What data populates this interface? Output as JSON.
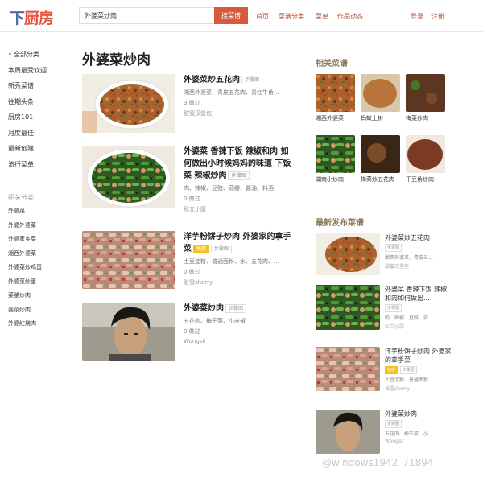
{
  "header": {
    "logo_first": "下",
    "logo_rest": "厨房",
    "search_value": "外婆菜炒肉",
    "search_button": "搜菜谱",
    "nav": [
      "首页",
      "菜谱分类",
      "菜单",
      "作品动态"
    ],
    "login": "登录",
    "register": "注册"
  },
  "sidebar": {
    "items": [
      "全部分类",
      "本周最受欢迎",
      "新秀菜谱",
      "往期头条",
      "厨房101",
      "月度最佳",
      "最新创建",
      "流行菜单"
    ],
    "related_title": "相关分类",
    "related": [
      "外婆菜",
      "外婆外婆菜",
      "外婆家乡菜",
      "湘西外婆菜",
      "外婆菜炒鸡蛋",
      "外婆菜炒蛋",
      "菜脯炒肉",
      "酱菜炒肉",
      "外婆红烧肉"
    ]
  },
  "main": {
    "title": "外婆菜炒肉",
    "recipes": [
      {
        "title": "外婆菜炒五花肉",
        "tag": "步骤图",
        "ingredients": "湘西外婆菜、青皮五花肉、青红牛角...",
        "count": "3 做过",
        "author": "甜蜜汉堡包"
      },
      {
        "title": "外婆菜 香辣下饭 辣椒和肉 如何做出小时候妈妈的味道 下饭菜 辣椒炒肉",
        "tag": "步骤图",
        "ingredients": "肉、辣椒、豆豉、蒜瓣、酱油、料酒",
        "count": "0 做过",
        "author": "私立小厨"
      },
      {
        "title": "洋芋粉饼子炒肉 外婆家的拿手菜",
        "tag_gold": "独家",
        "tag": "步骤图",
        "ingredients": "土豆淀粉、普通面粉、水、五花肉、...",
        "count": "0 做过",
        "author": "张雪sherry"
      },
      {
        "title": "外婆菜炒肉",
        "tag": "步骤图",
        "ingredients": "五花肉、梅干菜、小米椒",
        "count": "0 做过",
        "author": "Wongsir"
      }
    ]
  },
  "right": {
    "related_title": "相关菜谱",
    "related": [
      "湘西外婆菜",
      "蚂蚁上树",
      "梅菜炒肉",
      "湖南小炒肉",
      "梅菜炒五花肉",
      "干豆角炒肉"
    ],
    "new_title": "最新发布菜谱",
    "new_recipes": [
      {
        "title": "外婆菜炒五花肉",
        "tag": "步骤图",
        "sub": "湘西外婆菜、青皮五...",
        "author": "甜蜜汉堡包"
      },
      {
        "title": "外婆菜 香辣下饭 辣椒和肉如何做出...",
        "tag": "步骤图",
        "sub": "肉、辣椒、豆豉、蒜...",
        "author": "私立小厨"
      },
      {
        "title": "洋芋粉饼子炒肉 外婆家的拿手菜",
        "tag_gold": "独家",
        "tag": "步骤图",
        "sub": "土豆淀粉、普通面粉...",
        "author": "张雪sherry"
      },
      {
        "title": "外婆菜炒肉",
        "tag": "步骤图",
        "sub": "五花肉、梅干菜、小...",
        "author": "Wongsir"
      }
    ]
  },
  "watermark": "@windows1942_71894",
  "colors": {
    "brand": "#e4563b",
    "accent": "#d85a3c",
    "nav": "#b5523a",
    "section_title": "#8b7a58",
    "badge_gold": "#f3c21a"
  }
}
